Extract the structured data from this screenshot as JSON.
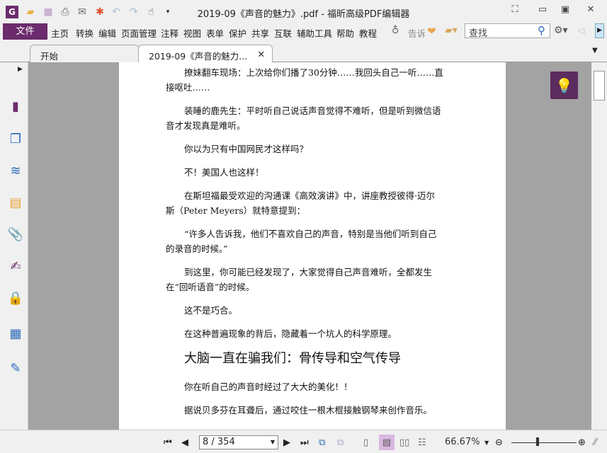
{
  "app": {
    "title": "2019-09《声音的魅力》.pdf - 福昕高级PDF编辑器",
    "brand_color": "#6b2b6c"
  },
  "quick_access": [
    "app-logo-icon",
    "open-folder-icon",
    "save-icon",
    "print-icon",
    "email-icon",
    "new-icon",
    "undo-icon",
    "redo-icon",
    "hand-tool-icon",
    "customize-icon"
  ],
  "menu": {
    "file": "文件",
    "items": [
      "主页",
      "转换",
      "编辑",
      "页面管理",
      "注释",
      "视图",
      "表单",
      "保护",
      "共享",
      "互联",
      "辅助工具",
      "帮助",
      "教程"
    ],
    "tell_me": "告诉",
    "search_placeholder": "查找"
  },
  "tabs": [
    {
      "label": "开始",
      "active": false
    },
    {
      "label": "2019-09《声音的魅力...",
      "active": true
    }
  ],
  "sidebar": [
    "bookmark-icon",
    "pages-icon",
    "layers-icon",
    "comments-icon",
    "attachments-icon",
    "signature-icon",
    "security-icon",
    "form-fields-icon",
    "certify-icon"
  ],
  "document": {
    "paragraphs": [
      {
        "lines": [
          "撩妹翻车现场：上次给你们播了30分钟……我回头自己一听……直",
          "接呕吐……"
        ]
      },
      {
        "lines": [
          "装睡的鹿先生：平时听自己说话声音觉得不难听，但是听到微信语",
          "音才发现真是难听。"
        ]
      },
      {
        "lines": [
          "你以为只有中国网民才这样吗？"
        ]
      },
      {
        "lines": [
          "不！美国人也这样！"
        ]
      },
      {
        "lines": [
          "在斯坦福最受欢迎的沟通课《高效演讲》中，讲座教授彼得·迈尔",
          "斯（Peter Meyers）就特意提到："
        ]
      },
      {
        "lines": [
          "“许多人告诉我，他们不喜欢自己的声音，特别是当他们听到自己",
          "的录音的时候。”"
        ]
      },
      {
        "lines": [
          "到这里，你可能已经发现了，大家觉得自己声音难听，全都发生",
          "在“回听语音”的时候。"
        ]
      },
      {
        "lines": [
          "这不是巧合。"
        ]
      },
      {
        "lines": [
          "在这种普遍现象的背后，隐藏着一个坑人的科学原理。"
        ]
      }
    ],
    "heading": "大脑一直在骗我们：骨传导和空气传导",
    "paragraphs2": [
      {
        "lines": [
          "你在听自己的声音时经过了大大的美化！！"
        ]
      },
      {
        "lines": [
          "据说贝多芬在耳聋后，通过咬住一根木棍接触钢琴来创作音乐。"
        ]
      }
    ]
  },
  "status": {
    "page": "8 / 354",
    "current_page": 8,
    "total_pages": 354,
    "zoom": "66.67%",
    "view_mode": "continuous"
  }
}
